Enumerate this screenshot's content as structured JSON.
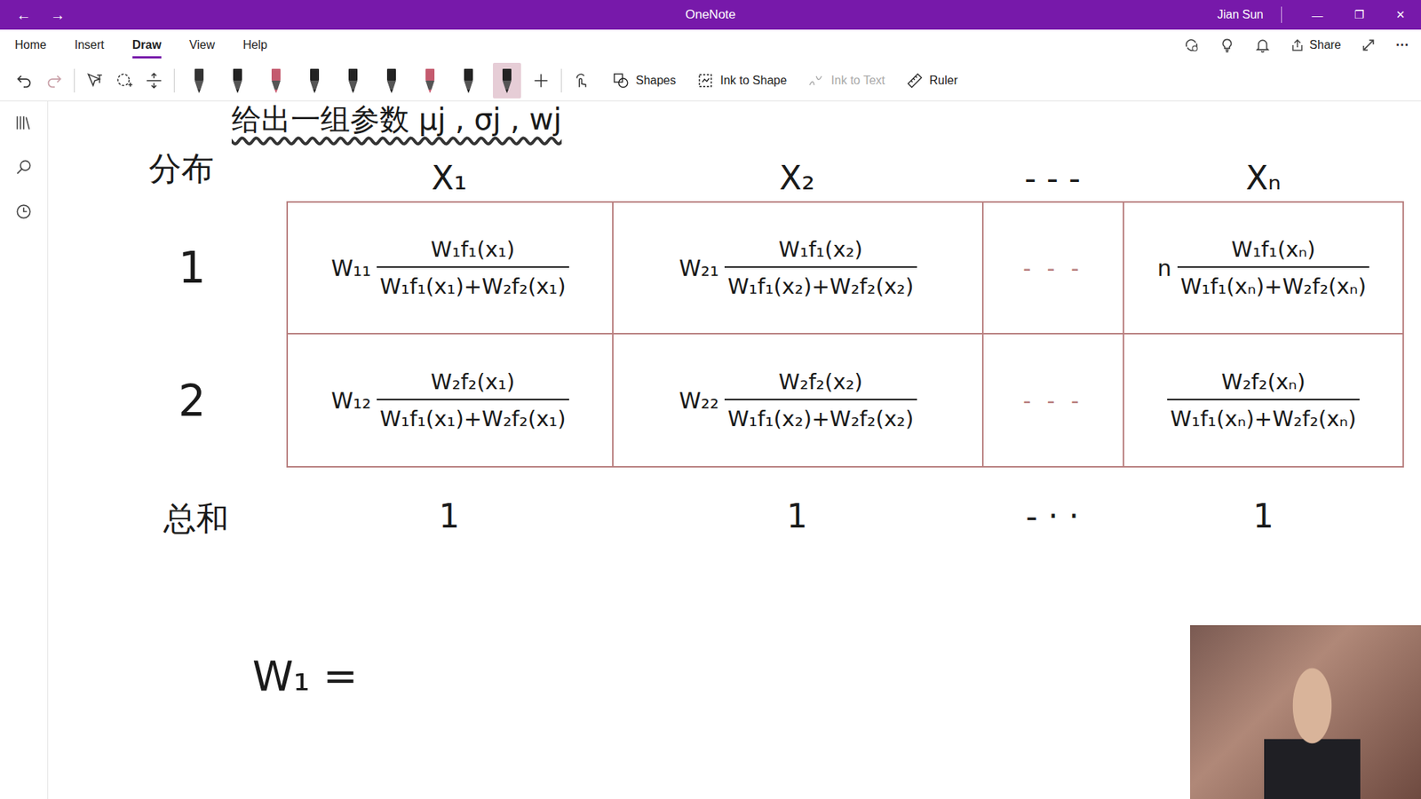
{
  "window": {
    "title": "OneNote",
    "user": "Jian Sun",
    "nav": [
      "←",
      "→"
    ],
    "controls": [
      "—",
      "❐",
      "✕"
    ]
  },
  "menu": {
    "tabs": [
      {
        "label": "Home",
        "selected": false
      },
      {
        "label": "Insert",
        "selected": false
      },
      {
        "label": "Draw",
        "selected": true
      },
      {
        "label": "View",
        "selected": false
      },
      {
        "label": "Help",
        "selected": false
      }
    ],
    "share": "Share",
    "more": "···"
  },
  "toolbar": {
    "pens": [
      {
        "color": "#333333",
        "selected": false
      },
      {
        "color": "#222222",
        "selected": false
      },
      {
        "color": "#c45a6e",
        "selected": false
      },
      {
        "color": "#222222",
        "selected": false
      },
      {
        "color": "#222222",
        "selected": false
      },
      {
        "color": "#222222",
        "selected": false
      },
      {
        "color": "#c45a6e",
        "selected": false
      },
      {
        "color": "#222222",
        "selected": false
      },
      {
        "color": "#222222",
        "selected": true
      }
    ],
    "tools": [
      {
        "label": "Shapes",
        "disabled": false
      },
      {
        "label": "Ink to Shape",
        "disabled": false
      },
      {
        "label": "Ink to Text",
        "disabled": true
      },
      {
        "label": "Ruler",
        "disabled": false
      }
    ]
  },
  "page": {
    "heading": "给出一组参数 μj , σj , wj",
    "distribution_label": "分布",
    "columns": [
      "X₁",
      "X₂",
      "- - -",
      "Xₙ"
    ],
    "rows": [
      {
        "label": "1",
        "cells": [
          {
            "kind": "fraction",
            "weight": "W₁₁",
            "numerator": "W₁f₁(x₁)",
            "denominator": "W₁f₁(x₁)+W₂f₂(x₁)"
          },
          {
            "kind": "fraction",
            "weight": "W₂₁",
            "numerator": "W₁f₁(x₂)",
            "denominator": "W₁f₁(x₂)+W₂f₂(x₂)"
          },
          {
            "kind": "ellipsis",
            "text": "- - -"
          },
          {
            "kind": "fraction",
            "weight": "n",
            "numerator": "W₁f₁(xₙ)",
            "denominator": "W₁f₁(xₙ)+W₂f₂(xₙ)"
          }
        ]
      },
      {
        "label": "2",
        "cells": [
          {
            "kind": "fraction",
            "weight": "W₁₂",
            "numerator": "W₂f₂(x₁)",
            "denominator": "W₁f₁(x₁)+W₂f₂(x₁)"
          },
          {
            "kind": "fraction",
            "weight": "W₂₂",
            "numerator": "W₂f₂(x₂)",
            "denominator": "W₁f₁(x₂)+W₂f₂(x₂)"
          },
          {
            "kind": "ellipsis",
            "text": "- - -"
          },
          {
            "kind": "fraction",
            "numerator": "W₂f₂(xₙ)",
            "denominator": "W₁f₁(xₙ)+W₂f₂(xₙ)"
          }
        ]
      }
    ],
    "sum": {
      "label": "总和",
      "values": [
        "1",
        "1",
        "- · ·",
        "1"
      ]
    },
    "formula": "W₁ ="
  }
}
